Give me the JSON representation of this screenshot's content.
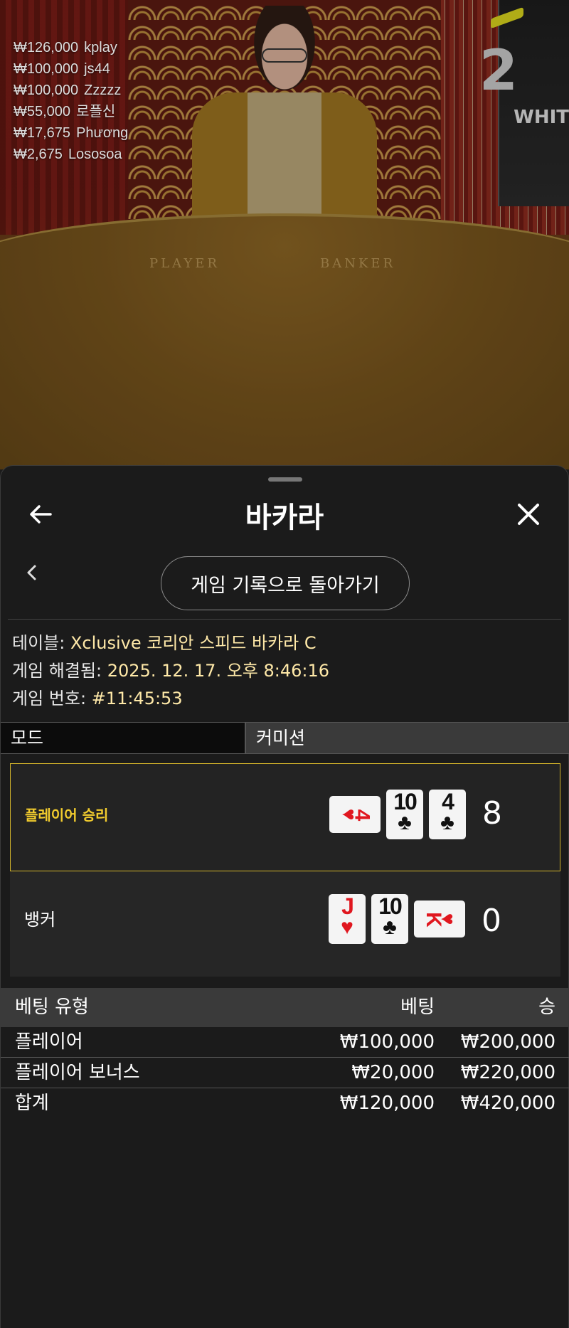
{
  "stream": {
    "round_number": "2",
    "tower_text": "WHIT",
    "table_labels": {
      "player": "PLAYER",
      "banker": "BANKER"
    },
    "winners": [
      {
        "amount": "₩126,000",
        "name": "kplay"
      },
      {
        "amount": "₩100,000",
        "name": "js44"
      },
      {
        "amount": "₩100,000",
        "name": "Zzzzz"
      },
      {
        "amount": "₩55,000",
        "name": "로플신"
      },
      {
        "amount": "₩17,675",
        "name": "Phương"
      },
      {
        "amount": "₩2,675",
        "name": "Lososoa"
      }
    ]
  },
  "sheet": {
    "title": "바카라",
    "back_icon": "arrow-left-icon",
    "close_icon": "close-icon",
    "history_button": "게임 기록으로 돌아가기",
    "info": {
      "table_label": "테이블:",
      "table_value": "Xclusive 코리안 스피드 바카라 C",
      "resolved_label": "게임 해결됨:",
      "resolved_value": "2025. 12. 17. 오후 8:46:16",
      "number_label": "게임 번호:",
      "number_value": "#11:45:53"
    },
    "mode_label": "모드",
    "commission_label": "커미션"
  },
  "result": {
    "player": {
      "label": "플레이어 승리",
      "score": "8",
      "cards": [
        {
          "rank": "4",
          "suit": "♥",
          "color": "red",
          "orientation": "horizontal"
        },
        {
          "rank": "10",
          "suit": "♣",
          "color": "black",
          "orientation": "vertical"
        },
        {
          "rank": "4",
          "suit": "♣",
          "color": "black",
          "orientation": "vertical"
        }
      ]
    },
    "banker": {
      "label": "뱅커",
      "score": "0",
      "cards": [
        {
          "rank": "J",
          "suit": "♥",
          "color": "red",
          "orientation": "vertical"
        },
        {
          "rank": "10",
          "suit": "♣",
          "color": "black",
          "orientation": "vertical"
        },
        {
          "rank": "K",
          "suit": "♥",
          "color": "red",
          "orientation": "horizontal"
        }
      ]
    }
  },
  "bets": {
    "headers": {
      "type": "베팅 유형",
      "bet": "베팅",
      "win": "승"
    },
    "rows": [
      {
        "type": "플레이어",
        "bet": "₩100,000",
        "win": "₩200,000"
      },
      {
        "type": "플레이어 보너스",
        "bet": "₩20,000",
        "win": "₩220,000"
      }
    ],
    "total": {
      "type": "합계",
      "bet": "₩120,000",
      "win": "₩420,000"
    }
  },
  "colors": {
    "win_highlight": "#d4b52b",
    "win_label": "#f2cc2e",
    "info_value": "#ffe9a8",
    "sheet_bg": "#1b1b1b",
    "card_red": "#e0171f"
  }
}
